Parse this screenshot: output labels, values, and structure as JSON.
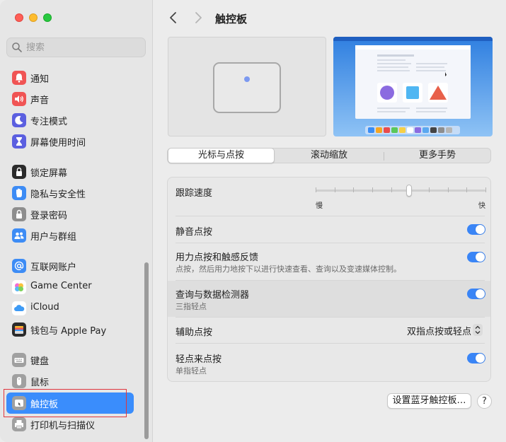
{
  "window": {
    "title": "触控板",
    "colors": {
      "accent": "#3a8dfc",
      "toggle_on": "#3a85f6",
      "highlight_outline": "#e0353d"
    }
  },
  "search": {
    "placeholder": "搜索",
    "icon": "search-icon"
  },
  "sidebar": {
    "items": [
      {
        "label": "通知",
        "icon": "bell-icon",
        "color": "#f05454"
      },
      {
        "label": "声音",
        "icon": "speaker-icon",
        "color": "#f05454"
      },
      {
        "label": "专注模式",
        "icon": "moon-icon",
        "color": "#5b5fe0"
      },
      {
        "label": "屏幕使用时间",
        "icon": "hourglass-icon",
        "color": "#5b5fe0"
      },
      {
        "label": "锁定屏幕",
        "icon": "lock-icon",
        "color": "#2b2b2b"
      },
      {
        "label": "隐私与安全性",
        "icon": "hand-icon",
        "color": "#3d8cf5"
      },
      {
        "label": "登录密码",
        "icon": "padlock-icon",
        "color": "#8e8e8e"
      },
      {
        "label": "用户与群组",
        "icon": "users-icon",
        "color": "#3d8cf5"
      },
      {
        "label": "互联网账户",
        "icon": "at-icon",
        "color": "#3d8cf5"
      },
      {
        "label": "Game Center",
        "icon": "game-center-icon",
        "color": "#ffffff"
      },
      {
        "label": "iCloud",
        "icon": "cloud-icon",
        "color": "#ffffff"
      },
      {
        "label": "钱包与 Apple Pay",
        "icon": "wallet-icon",
        "color": "#2b2b2b"
      },
      {
        "label": "键盘",
        "icon": "keyboard-icon",
        "color": "#a0a0a0"
      },
      {
        "label": "鼠标",
        "icon": "mouse-icon",
        "color": "#a0a0a0"
      },
      {
        "label": "触控板",
        "icon": "trackpad-icon",
        "color": "#a0a0a0",
        "selected": true
      },
      {
        "label": "打印机与扫描仪",
        "icon": "printer-icon",
        "color": "#a0a0a0"
      }
    ]
  },
  "tabs": [
    {
      "label": "光标与点按",
      "active": true
    },
    {
      "label": "滚动缩放",
      "active": false
    },
    {
      "label": "更多手势",
      "active": false
    }
  ],
  "settings": {
    "tracking": {
      "title": "跟踪速度",
      "min_label": "慢",
      "max_label": "快",
      "value": 0.55
    },
    "silent_click": {
      "title": "静音点按",
      "on": true
    },
    "force_click": {
      "title": "用力点按和触感反馈",
      "subtitle": "点按，然后用力地按下以进行快速查看、查询以及变速媒体控制。",
      "on": true
    },
    "lookup": {
      "title": "查询与数据检测器",
      "subtitle": "三指轻点",
      "on": true
    },
    "secondary_click": {
      "title": "辅助点按",
      "value": "双指点按或轻点"
    },
    "tap_to_click": {
      "title": "轻点来点按",
      "subtitle": "单指轻点",
      "on": true
    }
  },
  "footer": {
    "bluetooth_button": "设置蓝牙触控板…",
    "help_button": "?"
  }
}
